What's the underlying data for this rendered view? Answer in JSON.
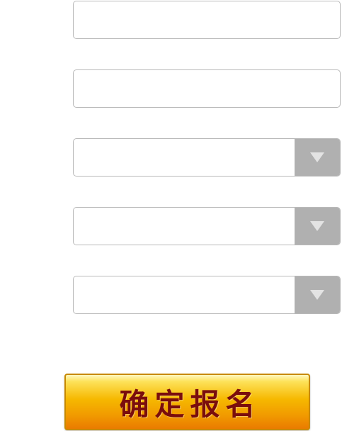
{
  "form": {
    "field1": {
      "value": "",
      "placeholder": ""
    },
    "field2": {
      "value": "",
      "placeholder": ""
    },
    "select1": {
      "value": ""
    },
    "select2": {
      "value": ""
    },
    "select3": {
      "value": ""
    },
    "submit_label": "确定报名"
  },
  "colors": {
    "field_border": "#b9b9b9",
    "dropdown_box": "#b0b0b0",
    "button_gold": "#f6b800",
    "button_text": "#7a0d0d"
  },
  "icons": {
    "dropdown": "chevron-down-icon"
  }
}
